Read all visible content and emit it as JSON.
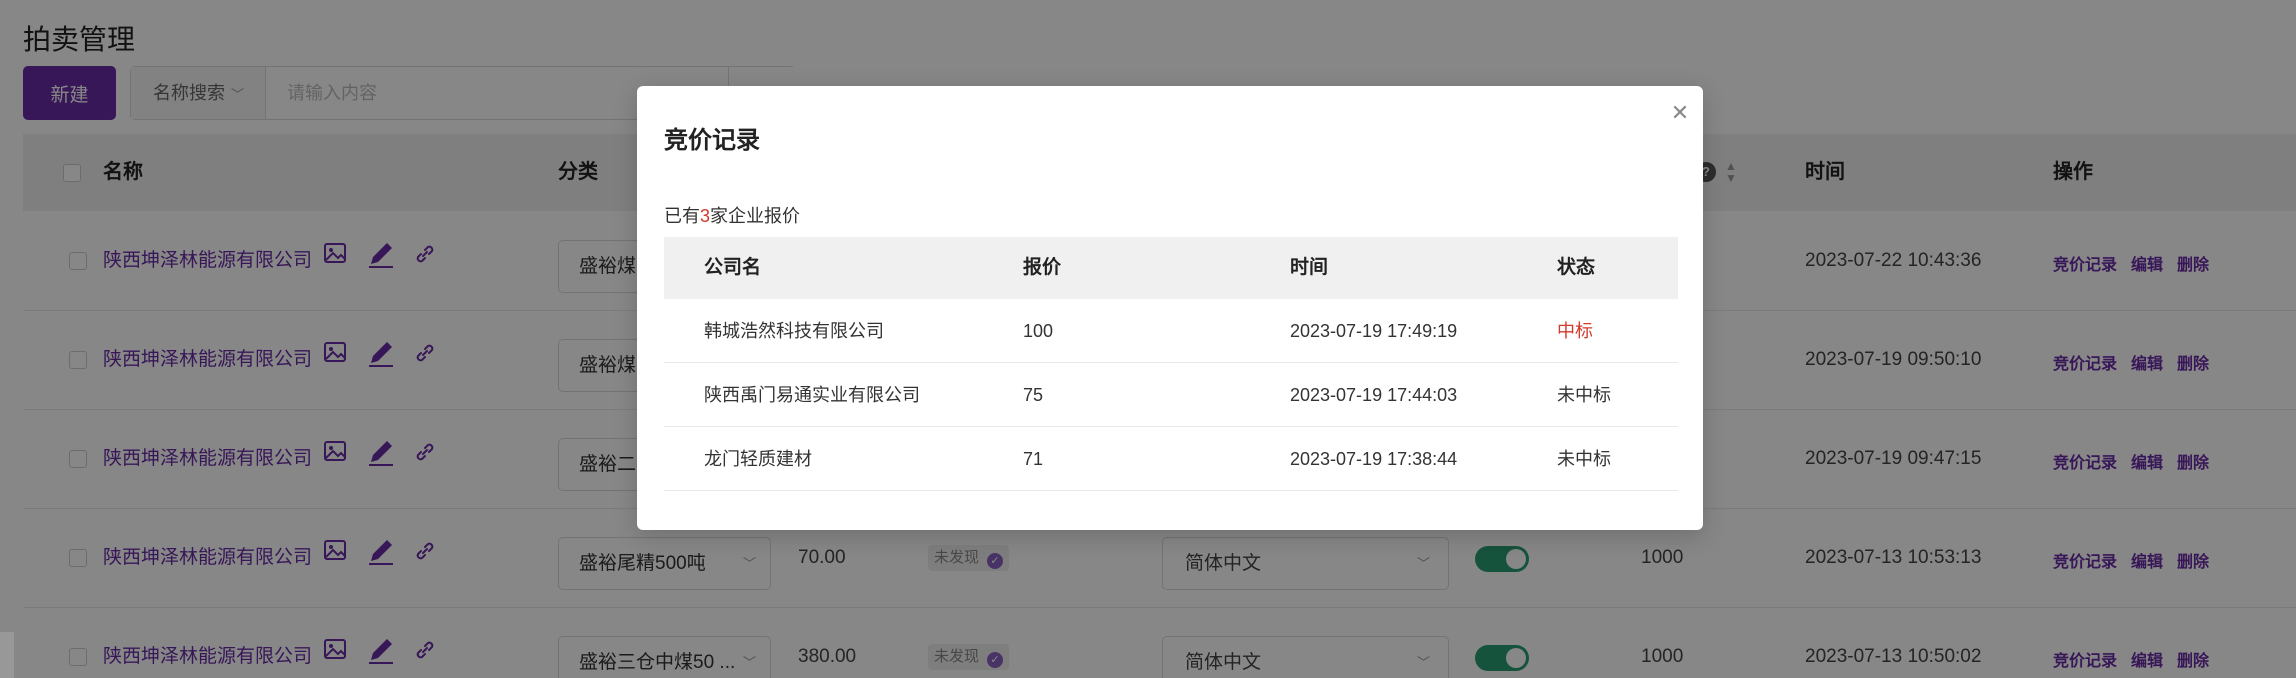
{
  "page": {
    "title": "拍卖管理",
    "new_button": "新建",
    "search": {
      "select_label": "名称搜索",
      "placeholder": "请输入内容"
    }
  },
  "table": {
    "columns": {
      "name": "名称",
      "category": "分类",
      "time": "时间",
      "actions": "操作"
    },
    "action_labels": {
      "bid_record": "竞价记录",
      "edit": "编辑",
      "delete": "删除"
    },
    "rows": [
      {
        "name": "陕西坤泽林能源有限公司",
        "category": "盛裕煤...",
        "time": "2023-07-22 10:43:36"
      },
      {
        "name": "陕西坤泽林能源有限公司",
        "category": "盛裕煤...",
        "time": "2023-07-19 09:50:10"
      },
      {
        "name": "陕西坤泽林能源有限公司",
        "category": "盛裕二...",
        "time": "2023-07-19 09:47:15"
      },
      {
        "name": "陕西坤泽林能源有限公司",
        "category": "盛裕尾精500吨",
        "price": "70.00",
        "badge": "未发现",
        "language": "简体中文",
        "quantity": "1000",
        "time": "2023-07-13 10:53:13"
      },
      {
        "name": "陕西坤泽林能源有限公司",
        "category": "盛裕三仓中煤50 ...",
        "price": "380.00",
        "badge": "未发现",
        "language": "简体中文",
        "quantity": "1000",
        "time": "2023-07-13 10:50:02"
      }
    ]
  },
  "modal": {
    "title": "竞价记录",
    "summary_prefix": "已有",
    "summary_count": "3",
    "summary_suffix": "家企业报价",
    "columns": {
      "company": "公司名",
      "price": "报价",
      "time": "时间",
      "status": "状态"
    },
    "rows": [
      {
        "company": "韩城浩然科技有限公司",
        "price": "100",
        "time": "2023-07-19 17:49:19",
        "status": "中标"
      },
      {
        "company": "陕西禹门易通实业有限公司",
        "price": "75",
        "time": "2023-07-19 17:44:03",
        "status": "未中标"
      },
      {
        "company": "龙门轻质建材",
        "price": "71",
        "time": "2023-07-19 17:38:44",
        "status": "未中标"
      }
    ]
  },
  "colors": {
    "accent": "#6a2ca6",
    "win": "#d23a2b",
    "toggle_on": "#2a9e72"
  }
}
